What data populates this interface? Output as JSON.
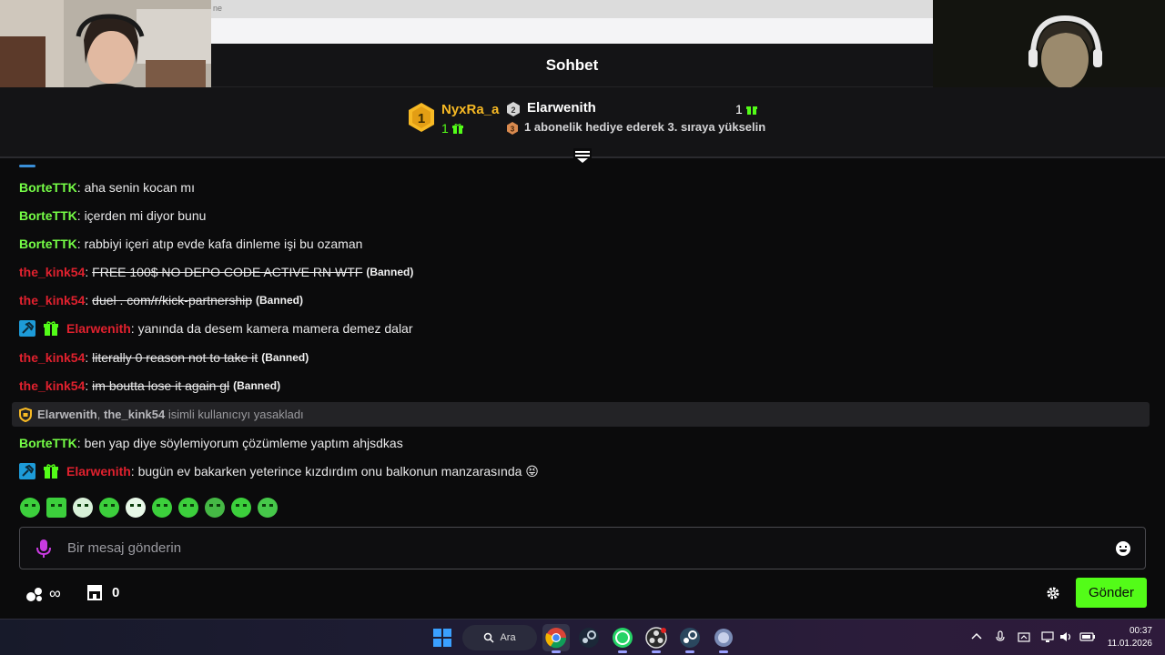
{
  "browser": {
    "tab_fragment": "ne"
  },
  "chat": {
    "title": "Sohbet",
    "leaderboard": {
      "first": {
        "rank": "1",
        "name": "NyxRa_a",
        "count": "1"
      },
      "second": {
        "rank": "2",
        "name": "Elarwenith",
        "count": "1"
      },
      "third_rank": "3",
      "hint": "1 abonelik hediye ederek 3. sıraya yükselin"
    },
    "messages": [
      {
        "user": "BorteTTK",
        "text": "aha senin kocan mı"
      },
      {
        "user": "BorteTTK",
        "text": "içerden mi diyor bunu"
      },
      {
        "user": "BorteTTK",
        "text": "rabbiyi içeri atıp evde kafa dinleme işi bu ozaman"
      },
      {
        "user": "the_kink54",
        "text": "FREE 100$ NO DEPO CODE ACTIVE RN WTF",
        "status": "(Banned)"
      },
      {
        "user": "the_kink54",
        "text": "duel . com/r/kick-partnership",
        "status": "(Banned)"
      },
      {
        "user": "Elarwenith",
        "text": "yanında da desem kamera mamera demez dalar"
      },
      {
        "user": "the_kink54",
        "text": "literally 0 reason not to take it",
        "status": "(Banned)"
      },
      {
        "user": "the_kink54",
        "text": "im boutta lose it again gl",
        "status": "(Banned)"
      },
      {
        "user": "BorteTTK",
        "text": "ben yap diye söylemiyorum çözümleme yaptım ahjsdkas"
      },
      {
        "user": "Elarwenith",
        "text": "bugün ev bakarken yeterince kızdırdım onu balkonun manzarasında",
        "emoji": "😝"
      }
    ],
    "mod_action": {
      "moderator": "Elarwenith",
      "separator": ",",
      "target": "the_kink54",
      "text": "isimli kullanıcıyı yasakladı"
    },
    "colon": ":",
    "input_placeholder": "Bir mesaj gönderin",
    "points_value": "∞",
    "store_count": "0",
    "send_label": "Gönder"
  },
  "taskbar": {
    "search_label": "Ara",
    "time": "00:37",
    "date": "11.01.2026"
  },
  "colors": {
    "accent_green": "#53fc18",
    "user_green": "#75fd46",
    "user_red": "#e0212e",
    "gold": "#f7b924"
  }
}
